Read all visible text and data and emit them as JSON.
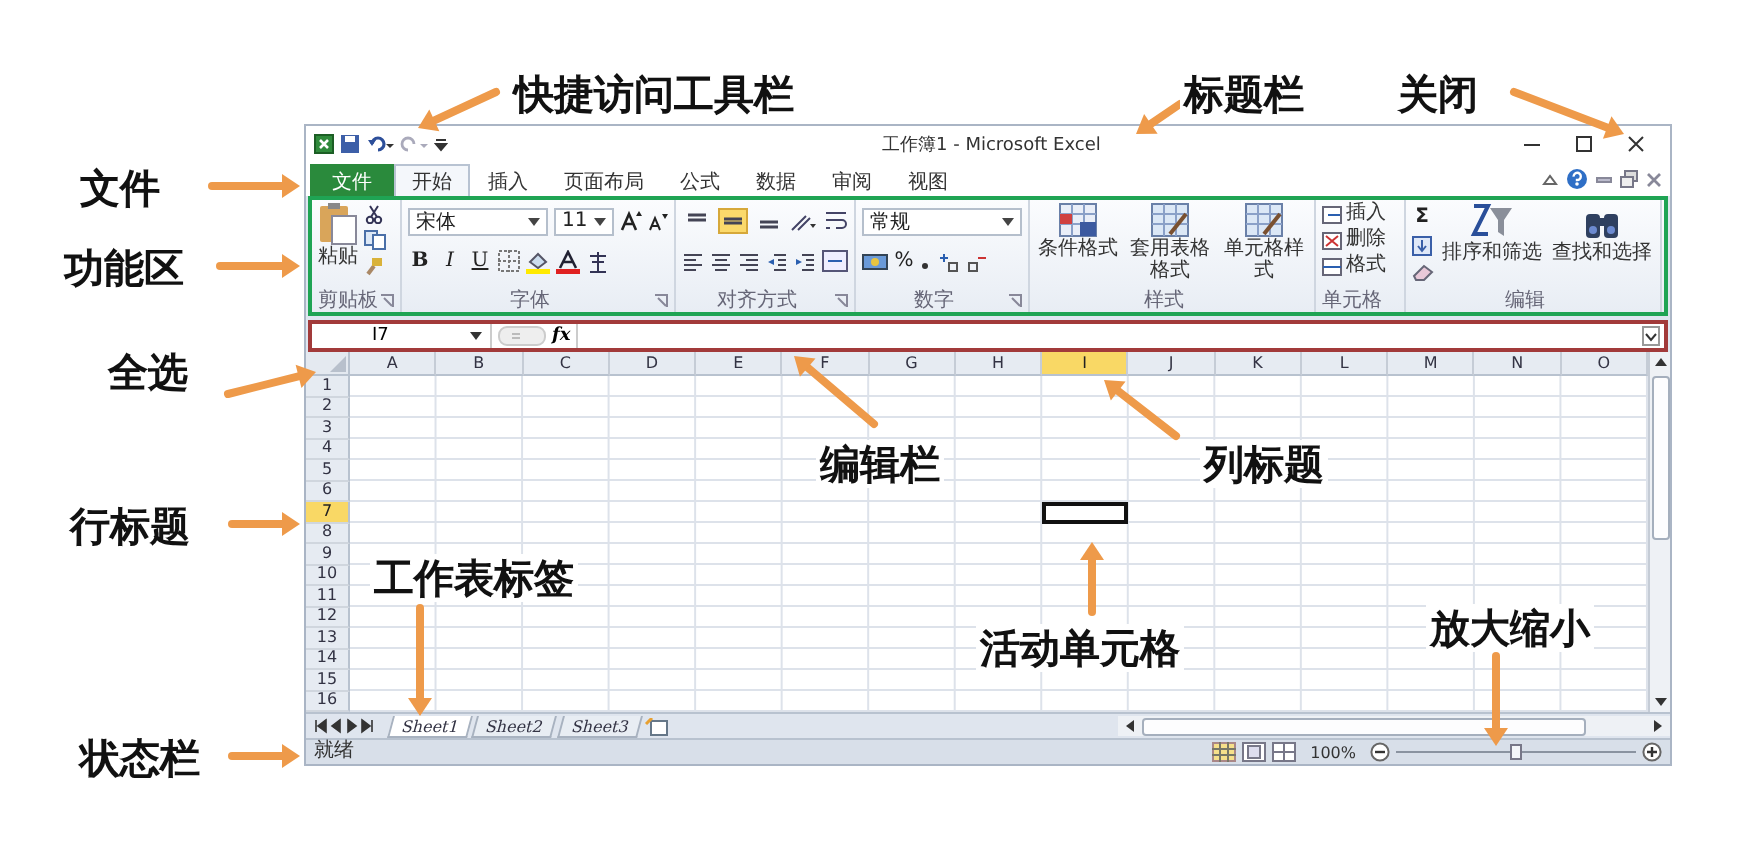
{
  "annotations": [
    {
      "label": "快捷访问工具栏"
    },
    {
      "label": "标题栏"
    },
    {
      "label": "关闭"
    },
    {
      "label": "文件"
    },
    {
      "label": "功能区"
    },
    {
      "label": "全选"
    },
    {
      "label": "行标题"
    },
    {
      "label": "状态栏"
    },
    {
      "label": "编辑栏"
    },
    {
      "label": "列标题"
    },
    {
      "label": "工作表标签"
    },
    {
      "label": "活动单元格"
    },
    {
      "label": "放大缩小"
    }
  ],
  "window": {
    "title": "工作簿1 - Microsoft Excel"
  },
  "tabs": [
    {
      "label": "文件",
      "kind": "file",
      "selected": false
    },
    {
      "label": "开始",
      "kind": "tab",
      "selected": true
    },
    {
      "label": "插入",
      "kind": "tab",
      "selected": false
    },
    {
      "label": "页面布局",
      "kind": "tab",
      "selected": false
    },
    {
      "label": "公式",
      "kind": "tab",
      "selected": false
    },
    {
      "label": "数据",
      "kind": "tab",
      "selected": false
    },
    {
      "label": "审阅",
      "kind": "tab",
      "selected": false
    },
    {
      "label": "视图",
      "kind": "tab",
      "selected": false
    }
  ],
  "ribbon": {
    "groups": [
      {
        "kind": "clipboard",
        "label": "剪贴板",
        "paste": "粘贴"
      },
      {
        "kind": "font",
        "label": "字体",
        "font": "宋体",
        "size": "11",
        "styles": [
          "B",
          "I",
          "U"
        ]
      },
      {
        "kind": "alignment",
        "label": "对齐方式",
        "vertical": [
          {
            "selected": false
          },
          {
            "selected": true
          },
          {
            "selected": false
          }
        ]
      },
      {
        "kind": "number",
        "label": "数字",
        "format": "常规",
        "percent": "%"
      },
      {
        "kind": "styles",
        "label": "样式",
        "buttons": [
          "条件格式",
          "套用表格格式",
          "单元格样式"
        ]
      },
      {
        "kind": "cells",
        "label": "单元格",
        "buttons": [
          "插入",
          "删除",
          "格式"
        ]
      },
      {
        "kind": "editing",
        "label": "编辑",
        "sum": "Σ",
        "buttons": [
          "排序和筛选",
          "查找和选择"
        ]
      }
    ]
  },
  "formula_bar": {
    "name_box": "I7",
    "fx": "fx"
  },
  "columns": [
    {
      "label": "A",
      "selected": false
    },
    {
      "label": "B",
      "selected": false
    },
    {
      "label": "C",
      "selected": false
    },
    {
      "label": "D",
      "selected": false
    },
    {
      "label": "E",
      "selected": false
    },
    {
      "label": "F",
      "selected": false
    },
    {
      "label": "G",
      "selected": false
    },
    {
      "label": "H",
      "selected": false
    },
    {
      "label": "I",
      "selected": true
    },
    {
      "label": "J",
      "selected": false
    },
    {
      "label": "K",
      "selected": false
    },
    {
      "label": "L",
      "selected": false
    },
    {
      "label": "M",
      "selected": false
    },
    {
      "label": "N",
      "selected": false
    },
    {
      "label": "O",
      "selected": false
    }
  ],
  "rows": [
    {
      "label": "1",
      "selected": false
    },
    {
      "label": "2",
      "selected": false
    },
    {
      "label": "3",
      "selected": false
    },
    {
      "label": "4",
      "selected": false
    },
    {
      "label": "5",
      "selected": false
    },
    {
      "label": "6",
      "selected": false
    },
    {
      "label": "7",
      "selected": true
    },
    {
      "label": "8",
      "selected": false
    },
    {
      "label": "9",
      "selected": false
    },
    {
      "label": "10",
      "selected": false
    },
    {
      "label": "11",
      "selected": false
    },
    {
      "label": "12",
      "selected": false
    },
    {
      "label": "13",
      "selected": false
    },
    {
      "label": "14",
      "selected": false
    },
    {
      "label": "15",
      "selected": false
    },
    {
      "label": "16",
      "selected": false
    }
  ],
  "sheet_tabs": [
    {
      "label": "Sheet1",
      "selected": true
    },
    {
      "label": "Sheet2",
      "selected": false
    },
    {
      "label": "Sheet3",
      "selected": false
    }
  ],
  "status_bar": {
    "status": "就绪",
    "zoom": "100%",
    "zoom_slider": {
      "level": 0.5
    }
  }
}
